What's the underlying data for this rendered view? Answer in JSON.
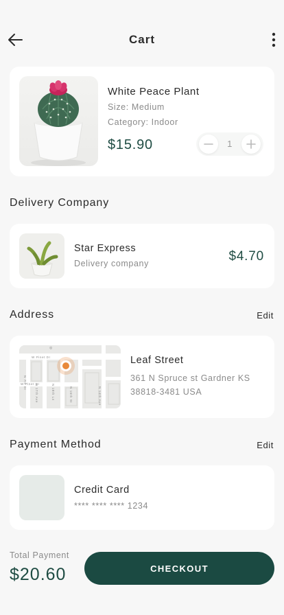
{
  "header": {
    "title": "Cart",
    "back_icon": "arrow-left-icon",
    "more_icon": "more-vertical-icon"
  },
  "product": {
    "name": "White Peace Plant",
    "size": "Size: Medium",
    "category": "Category: Indoor",
    "price": "$15.90",
    "quantity": "1",
    "image_icon": "cactus-pot-image"
  },
  "delivery": {
    "section_title": "Delivery Company",
    "name": "Star Express",
    "subtitle": "Delivery company",
    "price": "$4.70"
  },
  "address": {
    "section_title": "Address",
    "edit_label": "Edit",
    "name": "Leaf Street",
    "line1": "361 N Spruce st Gardner KS",
    "line2": "38818-3481 USA",
    "map_labels": {
      "street_top": "W Pinet Dr",
      "street_left": "W Pinet Dr",
      "ave_left": "N 7th Dr",
      "ave1": "N 17th Ave",
      "ave2": "N 18th Ln",
      "ave3": "N 16th St",
      "ave_right": "N 14th Ave"
    }
  },
  "payment": {
    "section_title": "Payment Method",
    "edit_label": "Edit",
    "name": "Credit Card",
    "number": "**** **** **** 1234"
  },
  "footer": {
    "total_label": "Total Payment",
    "total_value": "$20.60",
    "checkout_label": "CHECKOUT"
  },
  "colors": {
    "accent": "#1b4a42",
    "price": "#1f4c43",
    "map_pin": "#e8893a",
    "background": "#f7f7f7"
  }
}
